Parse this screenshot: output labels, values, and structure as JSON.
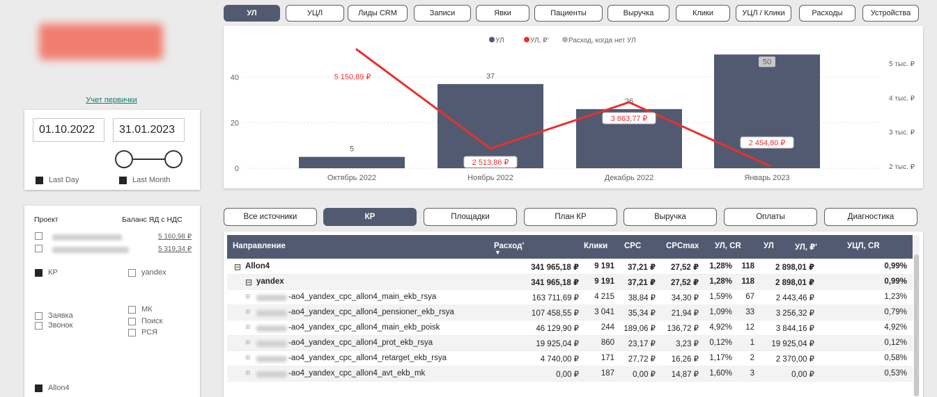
{
  "sidebar": {
    "uchet_link": "Учет первички",
    "date_from": "01.10.2022",
    "date_to": "31.01.2023",
    "last_day": "Last Day",
    "last_month": "Last Month",
    "filter_header_project": "Проект",
    "filter_header_balance": "Баланс ЯД с НДС",
    "balance_1": "5 160,98 ₽",
    "balance_2": "5 319,34 ₽",
    "kp": "КР",
    "yandex": "yandex",
    "zayavka": "Заявка",
    "zvonok": "Звонок",
    "mk": "МК",
    "poisk": "Поиск",
    "rsya": "РСЯ",
    "allon4": "Allon4"
  },
  "top_tabs": [
    "УЛ",
    "УЦЛ",
    "Лиды CRM",
    "Записи",
    "Явки",
    "Пациенты",
    "Выручка",
    "Клики",
    "УЦЛ / Клики",
    "Расходы",
    "Устройства"
  ],
  "second_tabs": [
    "Все источники",
    "КР",
    "Площадки",
    "План КР",
    "Выручка",
    "Оплаты",
    "Диагностика"
  ],
  "chart_data": {
    "type": "bar",
    "legend": [
      "УЛ",
      "УЛ, ₽'",
      "Расход, когда нет УЛ"
    ],
    "legend_position": "top-center",
    "categories": [
      "Октябрь 2022",
      "Ноябрь 2022",
      "Декабрь 2022",
      "Январь 2023"
    ],
    "series": [
      {
        "name": "УЛ",
        "type": "bar",
        "values": [
          5,
          37,
          26,
          50
        ],
        "color": "#515a70"
      },
      {
        "name": "УЛ, ₽'",
        "type": "line",
        "values": [
          5150.89,
          2513.86,
          3863.77,
          2454.8
        ],
        "labels": [
          "5 150,89 ₽",
          "2 513,86 ₽",
          "3 863,77 ₽",
          "2 454,80 ₽"
        ],
        "color": "#e8312f"
      }
    ],
    "y_left_ticks": [
      "0",
      "20",
      "40"
    ],
    "y_left_range": [
      0,
      55
    ],
    "y_right_ticks": [
      "2 тыс. ₽",
      "3 тыс. ₽",
      "4 тыс. ₽",
      "5 тыс. ₽"
    ],
    "y_right_range": [
      1940,
      5590
    ],
    "grid": true
  },
  "table": {
    "headers": [
      "Направление",
      "Расход'",
      "Клики",
      "CPC",
      "CPCmax",
      "УЛ, CR",
      "УЛ",
      "УЛ, ₽'",
      "УЦЛ, CR"
    ],
    "rows": [
      {
        "level": 0,
        "name": "Allon4",
        "cells": [
          "341 965,18 ₽",
          "9 191",
          "37,21 ₽",
          "27,52 ₽",
          "1,28%",
          "118",
          "2 898,01 ₽",
          "0,99%"
        ]
      },
      {
        "level": 1,
        "name": "yandex",
        "cells": [
          "341 965,18 ₽",
          "9 191",
          "37,21 ₽",
          "27,52 ₽",
          "1,28%",
          "118",
          "2 898,01 ₽",
          "0,99%"
        ]
      },
      {
        "level": 2,
        "name": "-ao4_yandex_cpc_allon4_main_ekb_rsya",
        "cells": [
          "163 711,69 ₽",
          "4 215",
          "38,84 ₽",
          "34,30 ₽",
          "1,59%",
          "67",
          "2 443,46 ₽",
          "1,23%"
        ]
      },
      {
        "level": 2,
        "name": "-ao4_yandex_cpc_allon4_pensioner_ekb_rsya",
        "cells": [
          "107 458,55 ₽",
          "3 041",
          "35,34 ₽",
          "21,94 ₽",
          "1,09%",
          "33",
          "3 256,32 ₽",
          "0,79%"
        ]
      },
      {
        "level": 2,
        "name": "-ao4_yandex_cpc_allon4_main_ekb_poisk",
        "cells": [
          "46 129,90 ₽",
          "244",
          "189,06 ₽",
          "136,72 ₽",
          "4,92%",
          "12",
          "3 844,16 ₽",
          "4,92%"
        ]
      },
      {
        "level": 2,
        "name": "-ao4_yandex_cpc_allon4_prot_ekb_rsya",
        "cells": [
          "19 925,04 ₽",
          "860",
          "23,17 ₽",
          "3,23 ₽",
          "0,12%",
          "1",
          "19 925,04 ₽",
          "0,12%"
        ]
      },
      {
        "level": 2,
        "name": "-ao4_yandex_cpc_allon4_retarget_ekb_rsya",
        "cells": [
          "4 740,00 ₽",
          "171",
          "27,72 ₽",
          "16,26 ₽",
          "1,17%",
          "2",
          "2 370,00 ₽",
          "0,58%"
        ]
      },
      {
        "level": 2,
        "name": "-ao4_yandex_cpc_allon4_avt_ekb_mk",
        "cells": [
          "0,00 ₽",
          "187",
          "0,00 ₽",
          "14,87 ₽",
          "1,60%",
          "3",
          "0,00 ₽",
          "0,53%"
        ]
      }
    ]
  }
}
